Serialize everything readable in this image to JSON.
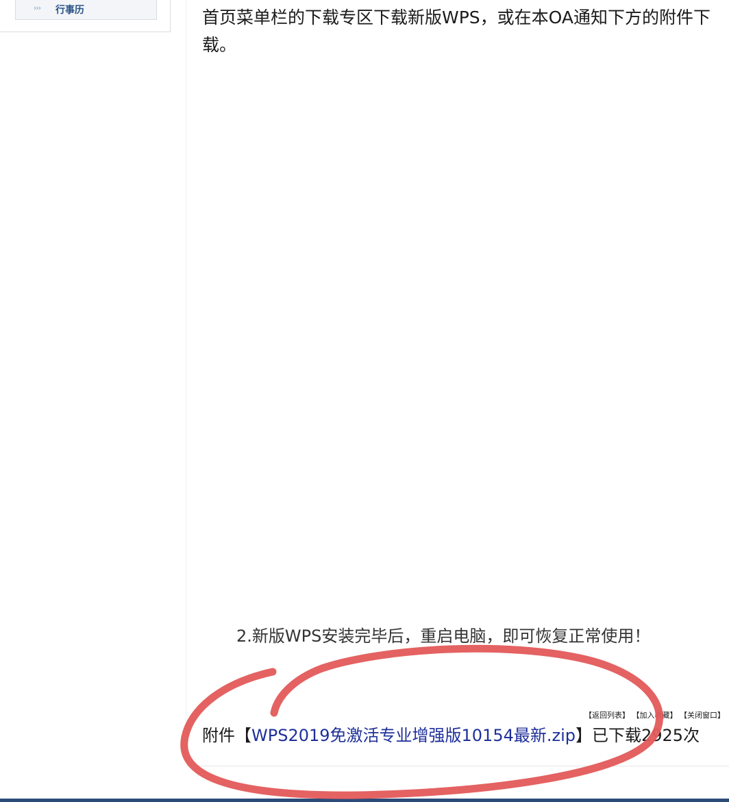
{
  "sidebar": {
    "bullet": "›››",
    "items": [
      {
        "label": "行事历"
      }
    ]
  },
  "content": {
    "paragraph1": "首页菜单栏的下载专区下载新版WPS，或在本OA通知下方的附件下载。",
    "paragraph2": "2.新版WPS安装完毕后，重启电脑，即可恢复正常使用！"
  },
  "actions": {
    "back_to_list": "【返回列表】",
    "add_favorite": "【加入收藏】",
    "close_window": "【关闭窗口】"
  },
  "attachment": {
    "prefix": "附件【",
    "file_name": "WPS2019免激活专业增强版10154最新.zip",
    "suffix": "】已下载2925次"
  },
  "colors": {
    "link": "#1e2f9a",
    "annotation_stroke": "#e35a5a",
    "sidebar_label": "#2a5386",
    "bottom_bar": "#2b4b78"
  }
}
